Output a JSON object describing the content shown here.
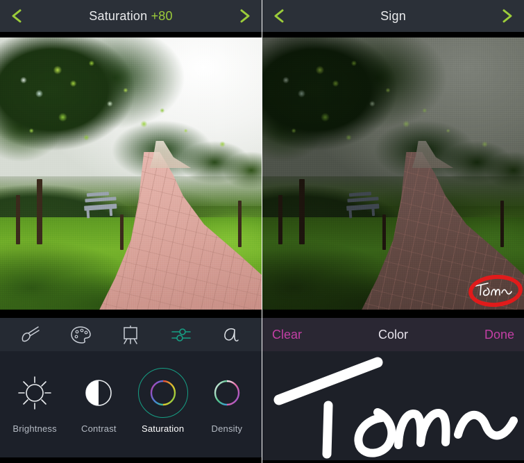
{
  "app": {
    "name": "photo-editor"
  },
  "left_panel": {
    "header": {
      "back_icon": "chevron-left-icon",
      "forward_icon": "chevron-right-icon",
      "title": "Saturation",
      "value": "+80",
      "value_color": "#9ccc3a"
    },
    "artwork": {
      "alt": "impressionist painting of a park with trees, lawn and a brick path",
      "state": "bright saturated"
    },
    "toolbar": {
      "items": [
        {
          "icon": "brush-icon",
          "label": "Brush",
          "active": false
        },
        {
          "icon": "palette-icon",
          "label": "Palette",
          "active": false
        },
        {
          "icon": "easel-icon",
          "label": "Easel",
          "active": false
        },
        {
          "icon": "sliders-icon",
          "label": "Adjust",
          "active": true
        },
        {
          "icon": "script-a-icon",
          "label": "Text",
          "active": false
        }
      ],
      "active_color": "#16a085",
      "inactive_color": "#c9ced6"
    },
    "adjustments": {
      "items": [
        {
          "icon": "sun-icon",
          "label": "Brightness",
          "active": false
        },
        {
          "icon": "contrast-half-circle-icon",
          "label": "Contrast",
          "active": false
        },
        {
          "icon": "hue-ring-icon",
          "label": "Saturation",
          "active": true
        },
        {
          "icon": "density-ring-icon",
          "label": "Density",
          "active": false
        }
      ],
      "selection_ring_color": "#16a085"
    }
  },
  "right_panel": {
    "header": {
      "back_icon": "chevron-left-icon",
      "forward_icon": "chevron-right-icon",
      "title": "Sign",
      "value": ""
    },
    "artwork": {
      "alt": "same park painting, darkened / desaturated preview",
      "state": "dark"
    },
    "annotation": {
      "shape": "red-ellipse-highlight",
      "color": "#e01b1b",
      "target": "signature-stamp"
    },
    "signature_stamp": {
      "text": "Tom",
      "color": "#ffffff"
    },
    "signbar": {
      "clear_label": "Clear",
      "color_label": "Color",
      "done_label": "Done",
      "accent": "#c33fa5"
    },
    "signature_pad": {
      "drawn_text": "Tom",
      "stroke_color": "#ffffff"
    }
  },
  "colors": {
    "header_bg": "#2b3038",
    "toolbar_bg": "#252a33",
    "adjust_bg": "#1c2029",
    "signbar_bg": "#2a2733",
    "signpad_bg": "#1d2028",
    "chevron_green": "#9ccc3a"
  }
}
